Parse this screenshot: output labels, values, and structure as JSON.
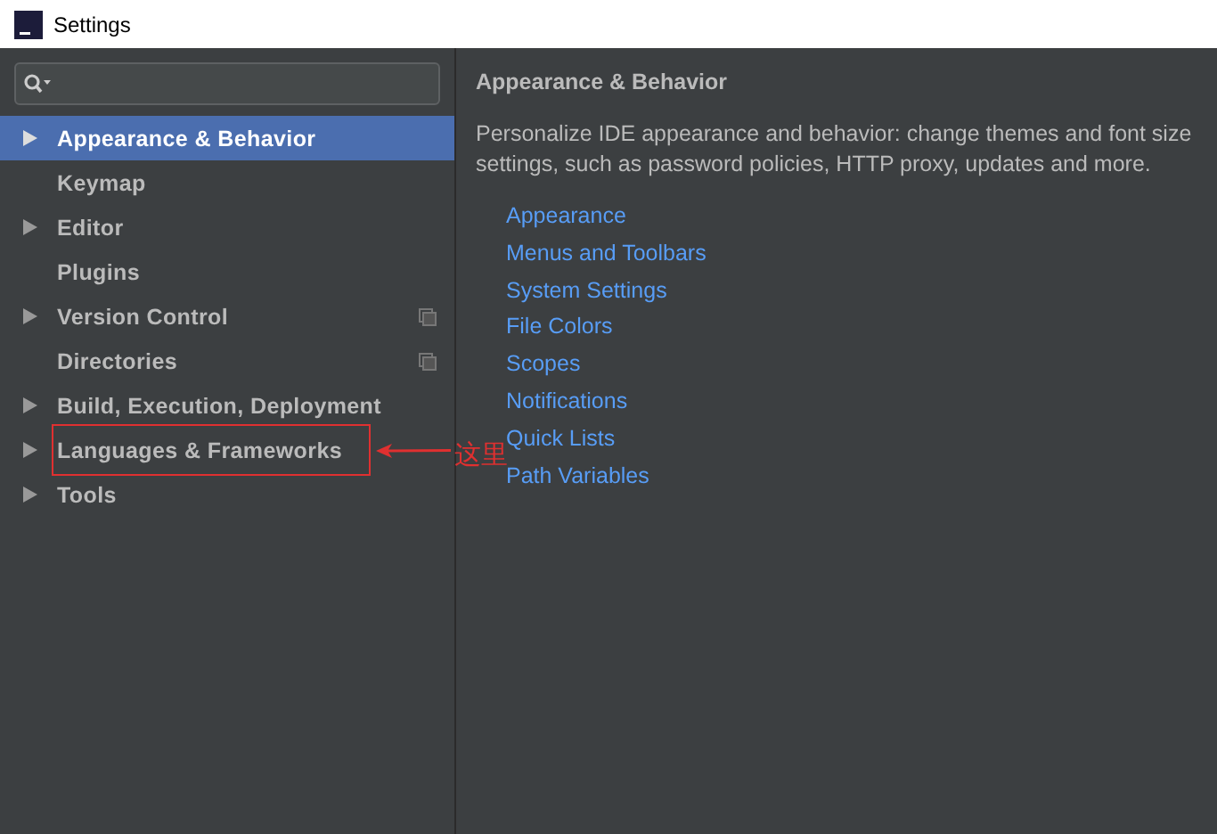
{
  "window": {
    "title": "Settings"
  },
  "sidebar": {
    "items": [
      {
        "label": "Appearance & Behavior",
        "expandable": true,
        "selected": true,
        "shared": false,
        "annotated": false
      },
      {
        "label": "Keymap",
        "expandable": false,
        "selected": false,
        "shared": false,
        "annotated": false
      },
      {
        "label": "Editor",
        "expandable": true,
        "selected": false,
        "shared": false,
        "annotated": false
      },
      {
        "label": "Plugins",
        "expandable": false,
        "selected": false,
        "shared": false,
        "annotated": false
      },
      {
        "label": "Version Control",
        "expandable": true,
        "selected": false,
        "shared": true,
        "annotated": false
      },
      {
        "label": "Directories",
        "expandable": false,
        "selected": false,
        "shared": true,
        "annotated": false
      },
      {
        "label": "Build, Execution, Deployment",
        "expandable": true,
        "selected": false,
        "shared": false,
        "annotated": false
      },
      {
        "label": "Languages & Frameworks",
        "expandable": true,
        "selected": false,
        "shared": false,
        "annotated": true
      },
      {
        "label": "Tools",
        "expandable": true,
        "selected": false,
        "shared": false,
        "annotated": false
      }
    ]
  },
  "annotation": {
    "label": "这里"
  },
  "content": {
    "heading": "Appearance & Behavior",
    "description_lines": [
      "Personalize IDE appearance and behavior: change themes and font size",
      "settings, such as password policies, HTTP proxy, updates and more."
    ],
    "links": [
      "Appearance",
      "Menus and Toolbars",
      "System Settings",
      "File Colors",
      "Scopes",
      "Notifications",
      "Quick Lists",
      "Path Variables"
    ]
  }
}
